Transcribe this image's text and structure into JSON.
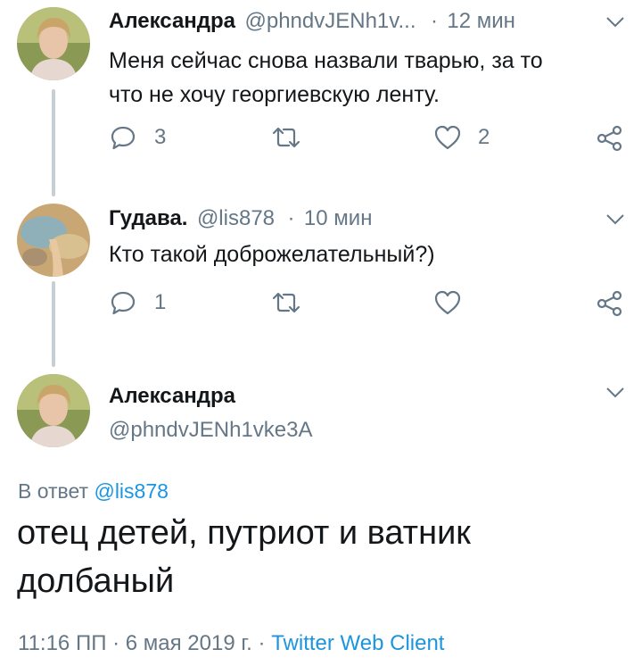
{
  "tweets": [
    {
      "name": "Александра",
      "handle": "@phndvJENh1v...",
      "dot": "·",
      "time": "12 мин",
      "text_lines": [
        "Меня сейчас снова назвали тварью, за то",
        "что не хочу георгиевскую ленту."
      ],
      "replies": "3",
      "retweets": "",
      "likes": "2"
    },
    {
      "name": "Гудава.",
      "handle": "@lis878",
      "dot": "·",
      "time": "10 мин",
      "text_lines": [
        "Кто такой доброжелательный?)"
      ],
      "replies": "1",
      "retweets": "",
      "likes": ""
    }
  ],
  "main_tweet": {
    "name": "Александра",
    "handle": "@phndvJENh1vke3A",
    "reply_prefix": "В ответ",
    "reply_to": "@lis878",
    "text_lines": [
      "отец детей, путриот и ватник",
      "долбаный"
    ],
    "timestamp": "11:16 ПП · 6 мая 2019 г. · ",
    "client": "Twitter Web Client"
  },
  "colors": {
    "text": "#14171a",
    "secondary": "#657786",
    "link": "#1b95e0",
    "thread_line": "#c4cfd6"
  },
  "icons": [
    "reply-icon",
    "retweet-icon",
    "like-icon",
    "share-icon",
    "chevron-down-icon"
  ]
}
